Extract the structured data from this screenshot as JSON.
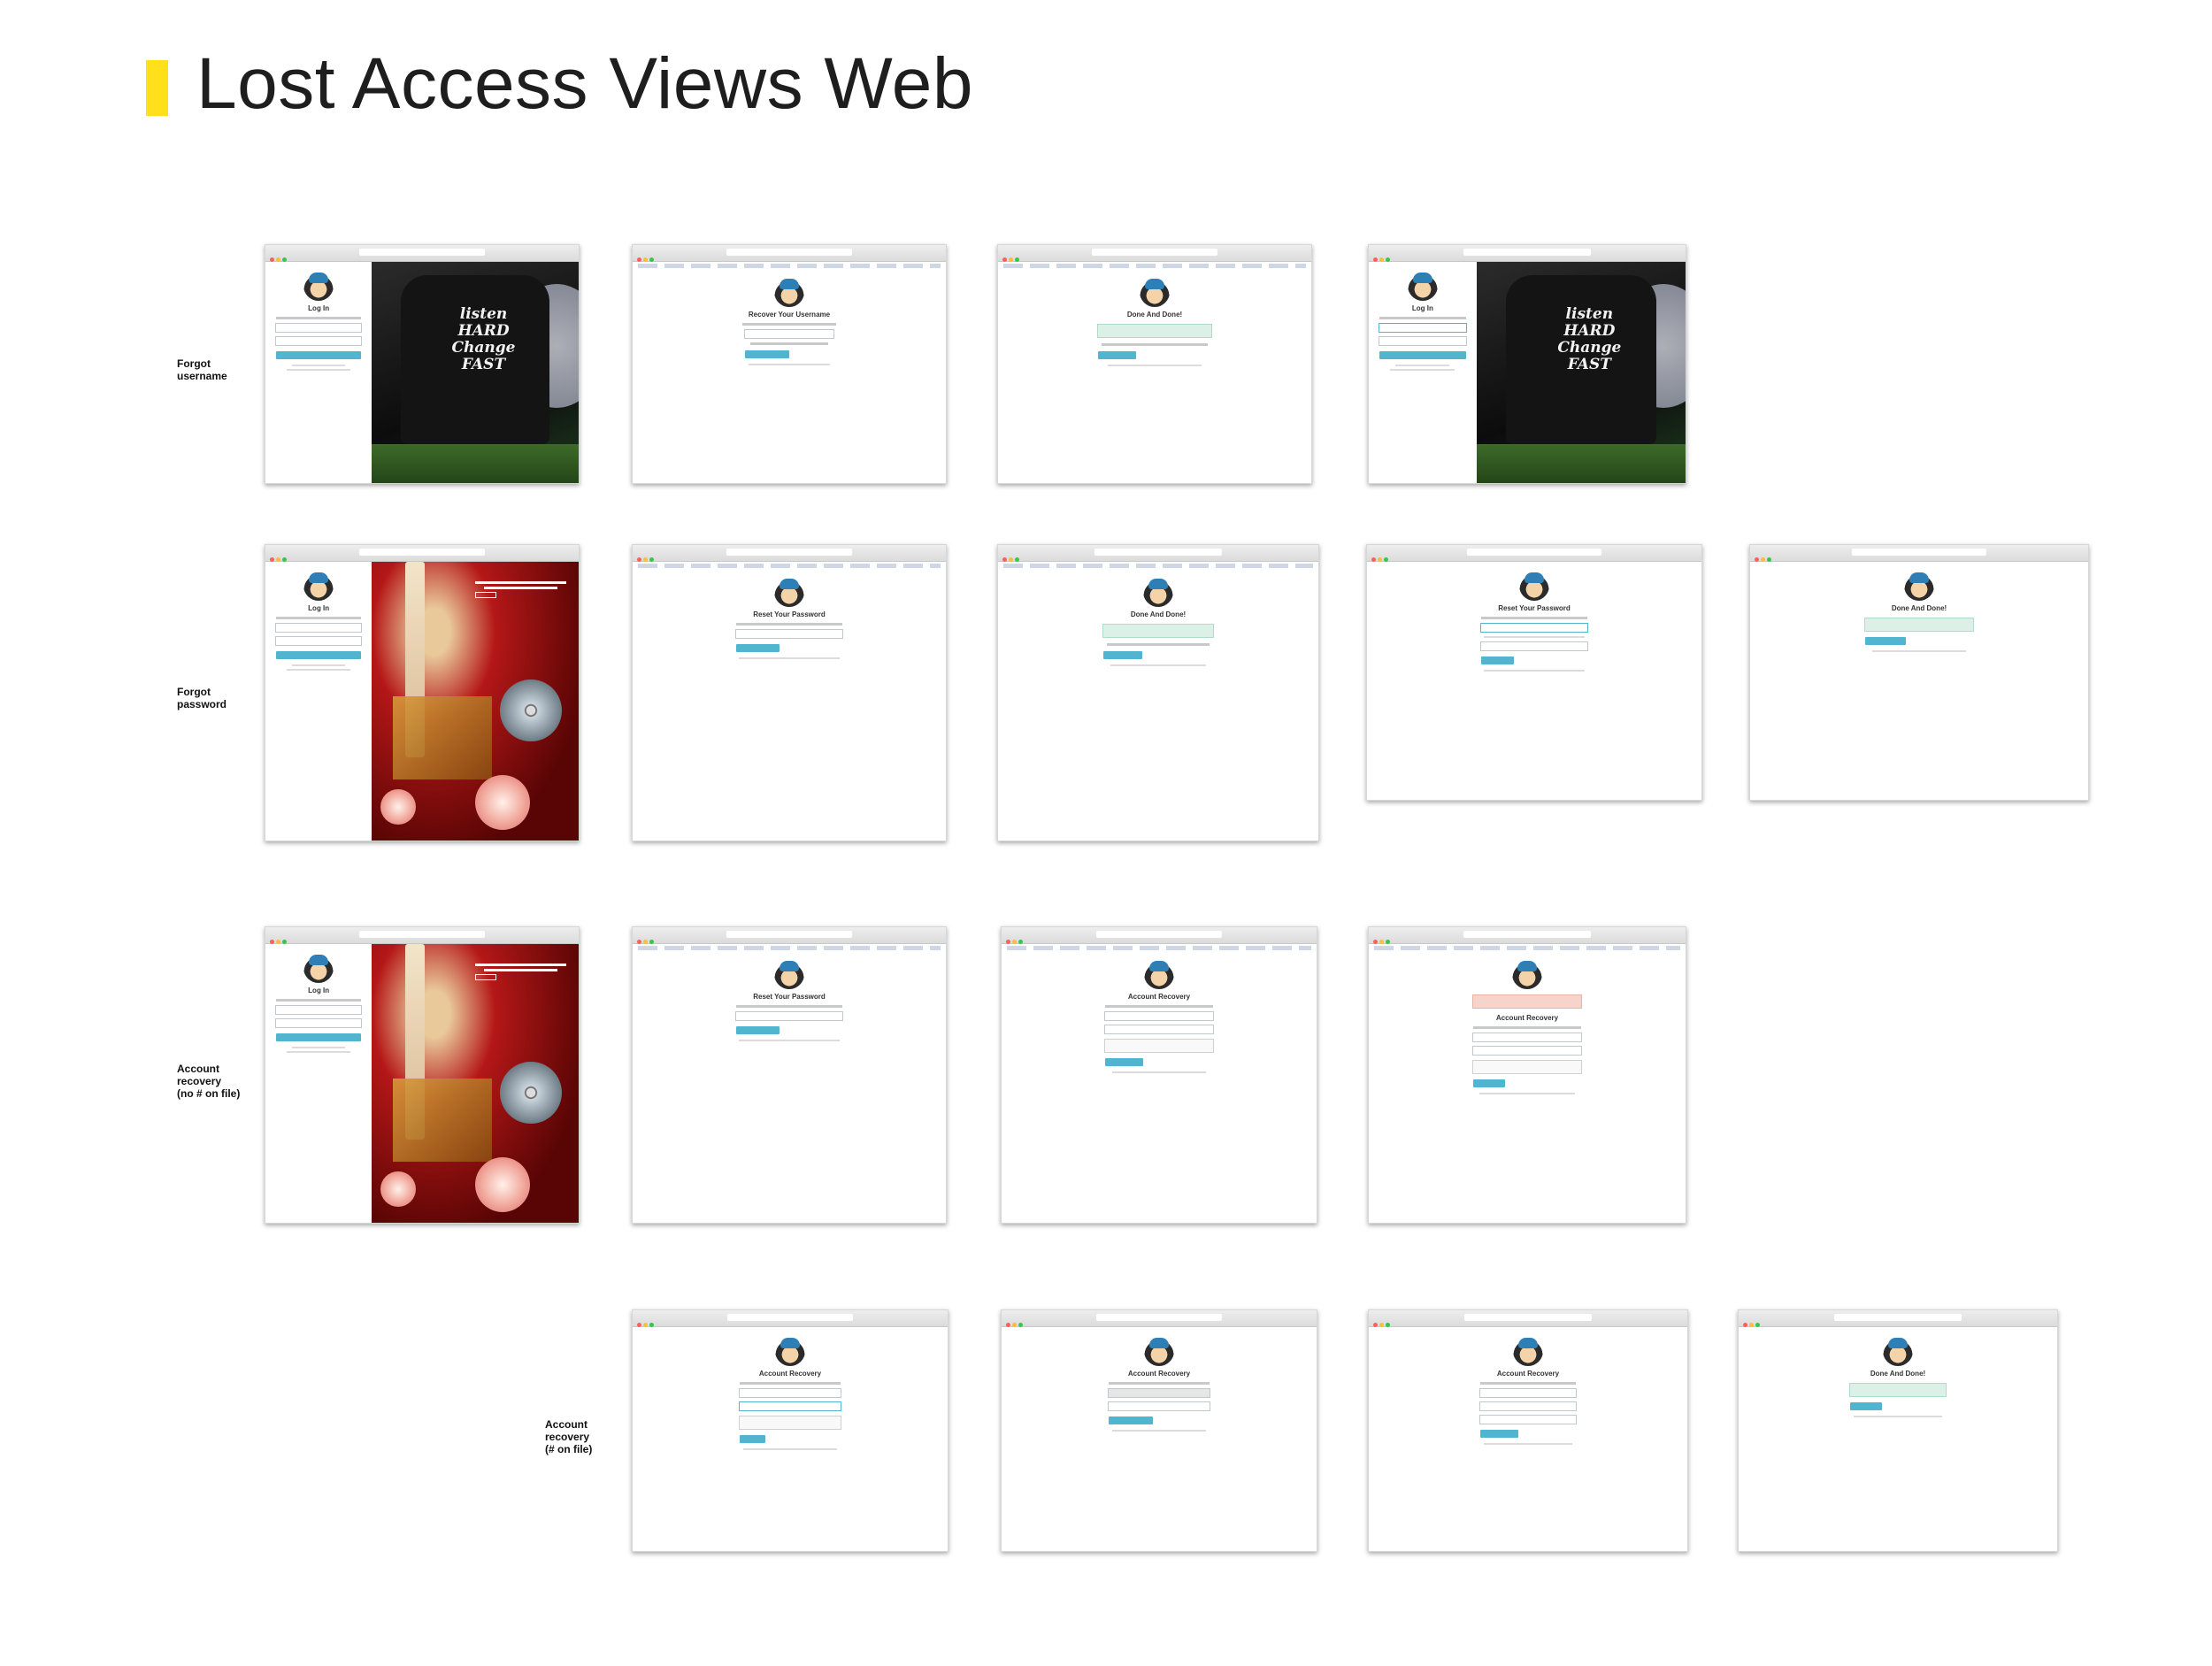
{
  "page": {
    "title": "Lost Access Views Web",
    "accent_color": "#ffe01b"
  },
  "rows": [
    {
      "label_lines": [
        "Forgot",
        "username"
      ]
    },
    {
      "label_lines": [
        "Forgot",
        "password"
      ]
    },
    {
      "label_lines": [
        "Account",
        "recovery",
        "(no # on file)"
      ]
    },
    {
      "label_lines": [
        "Account",
        "recovery",
        "(# on file)"
      ]
    }
  ],
  "hero_text": {
    "jacket_words": [
      "listen",
      "HARD",
      "Change",
      "FAST"
    ]
  },
  "screens": {
    "row1": [
      "Log In",
      "Recover Your Username",
      "Done And Done!",
      "Log In"
    ],
    "row2": [
      "Log In",
      "Reset Your Password",
      "Done And Done!",
      "Reset Your Password",
      "Done And Done!"
    ],
    "row3": [
      "Log In",
      "Reset Your Password",
      "Account Recovery",
      "Account Recovery"
    ],
    "row4": [
      "Account Recovery",
      "Account Recovery",
      "Account Recovery",
      "Done And Done!"
    ]
  },
  "colors": {
    "button": "#52b5d0",
    "success": "#dbf0e6",
    "error": "#f6d4cc"
  }
}
